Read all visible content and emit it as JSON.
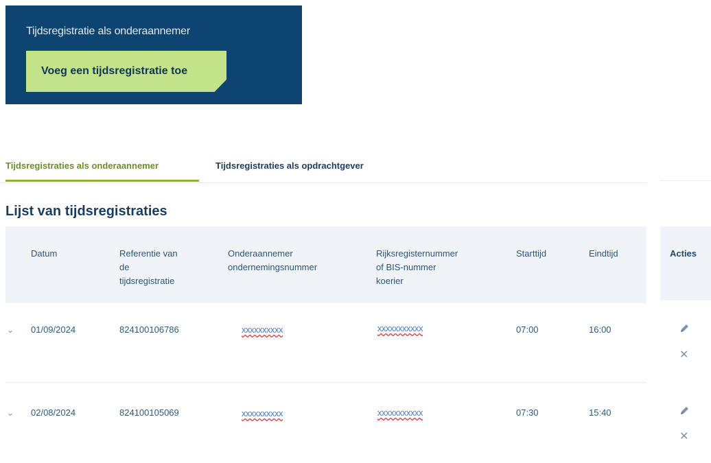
{
  "hero": {
    "title": "Tijdsregistratie als onderaannemer",
    "add_button_label": "Voeg een tijdsregistratie toe"
  },
  "tabs": [
    {
      "label": "Tijdsregistraties als onderaannemer",
      "active": true
    },
    {
      "label": "Tijdsregistraties als opdrachtgever",
      "active": false
    }
  ],
  "section_title": "Lijst van tijdsregistraties",
  "table": {
    "columns": [
      [
        "Datum"
      ],
      [
        "Referentie van",
        "de",
        "tijdsregistratie"
      ],
      [
        "Onderaannemer",
        "ondernemingsnummer"
      ],
      [
        "Rijksregisternummer",
        "of BIS-nummer",
        "koerier"
      ],
      [
        "Starttijd"
      ],
      [
        "Eindtijd"
      ],
      [
        "Acties"
      ]
    ],
    "rows": [
      {
        "date": "01/09/2024",
        "reference": "824100106786",
        "company_number": "xxxxxxxxxx",
        "national_number": "xxxxxxxxxxx",
        "start": "07:00",
        "end": "16:00"
      },
      {
        "date": "02/08/2024",
        "reference": "824100105069",
        "company_number": "xxxxxxxxxx",
        "national_number": "xxxxxxxxxxx",
        "start": "07:30",
        "end": "15:40"
      }
    ]
  },
  "icons": {
    "expand": "chevron-down-icon",
    "edit": "pencil-icon",
    "delete": "close-icon"
  },
  "colors": {
    "hero_bg": "#0e4570",
    "cta_bg": "#c3e38a",
    "active_tab": "#8fb13e",
    "redaction_underline": "#d8383f"
  }
}
